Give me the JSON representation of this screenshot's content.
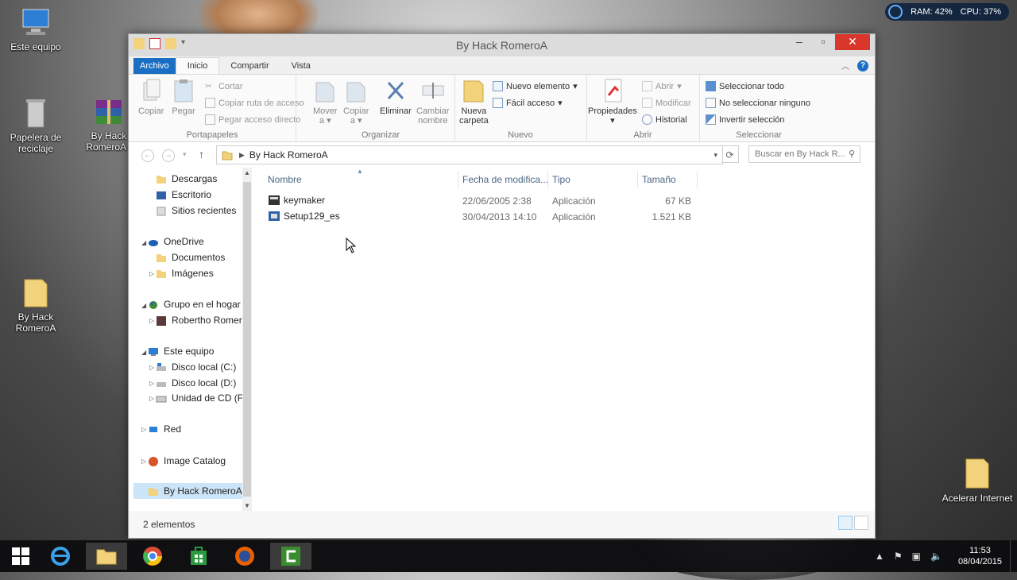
{
  "desktop": {
    "icons": [
      {
        "label": "Este equipo"
      },
      {
        "label": "Papelera de reciclaje"
      },
      {
        "label": "By Hack RomeroA ("
      },
      {
        "label": "By Hack RomeroA"
      },
      {
        "label": "Acelerar Internet"
      }
    ],
    "widget": {
      "ram": "RAM: 42%",
      "cpu": "CPU: 37%"
    }
  },
  "window": {
    "title": "By Hack RomeroA",
    "tabs": [
      "Archivo",
      "Inicio",
      "Compartir",
      "Vista"
    ],
    "ribbon": {
      "portapapeles": {
        "name": "Portapapeles",
        "copiar": "Copiar",
        "pegar": "Pegar",
        "cortar": "Cortar",
        "copiar_ruta": "Copiar ruta de acceso",
        "pegar_acceso": "Pegar acceso directo"
      },
      "organizar": {
        "name": "Organizar",
        "mover": "Mover",
        "mover2": "a",
        "copiar": "Copiar",
        "copiar2": "a",
        "eliminar": "Eliminar",
        "cambiar": "Cambiar",
        "cambiar2": "nombre"
      },
      "nuevo": {
        "name": "Nuevo",
        "nueva": "Nueva",
        "nueva2": "carpeta",
        "nuevo_elemento": "Nuevo elemento",
        "facil_acceso": "Fácil acceso"
      },
      "abrir": {
        "name": "Abrir",
        "propiedades": "Propiedades",
        "abrir": "Abrir",
        "modificar": "Modificar",
        "historial": "Historial"
      },
      "seleccionar": {
        "name": "Seleccionar",
        "todo": "Seleccionar todo",
        "ninguno": "No seleccionar ninguno",
        "invertir": "Invertir selección"
      }
    },
    "address": {
      "crumb": "By Hack RomeroA",
      "search_placeholder": "Buscar en By Hack R..."
    },
    "nav": {
      "descargas": "Descargas",
      "escritorio": "Escritorio",
      "sitios": "Sitios recientes",
      "onedrive": "OneDrive",
      "documentos": "Documentos",
      "imagenes": "Imágenes",
      "grupo": "Grupo en el hogar",
      "roberto": "Robertho Romero",
      "equipo": "Este equipo",
      "discoC": "Disco local (C:)",
      "discoD": "Disco local (D:)",
      "cd": "Unidad de CD (F:)",
      "red": "Red",
      "imagecatalog": "Image Catalog",
      "byhack": "By Hack RomeroA"
    },
    "columns": {
      "nombre": "Nombre",
      "fecha": "Fecha de modifica...",
      "tipo": "Tipo",
      "tamano": "Tamaño"
    },
    "files": [
      {
        "name": "keymaker",
        "date": "22/06/2005 2:38",
        "type": "Aplicación",
        "size": "67 KB"
      },
      {
        "name": "Setup129_es",
        "date": "30/04/2013 14:10",
        "type": "Aplicación",
        "size": "1.521 KB"
      }
    ],
    "status": "2 elementos"
  },
  "taskbar": {
    "time": "11:53",
    "date": "08/04/2015"
  }
}
